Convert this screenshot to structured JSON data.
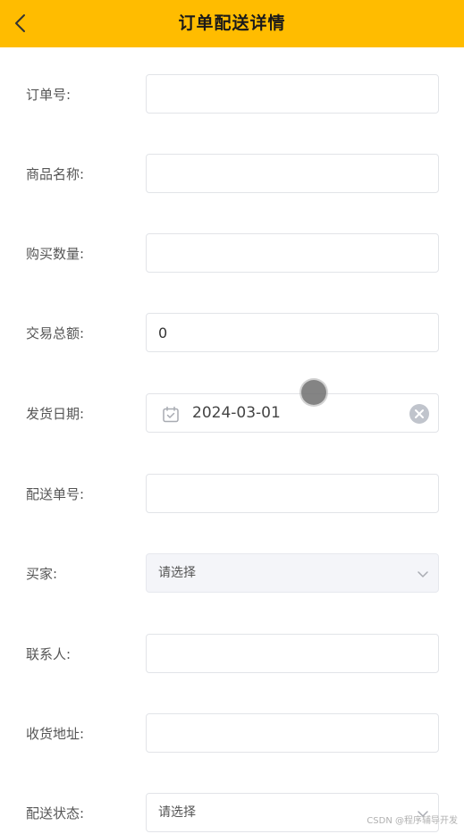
{
  "header": {
    "title": "订单配送详情",
    "background": "#FFBC00"
  },
  "form": {
    "order_no": {
      "label": "订单号:",
      "value": ""
    },
    "product_name": {
      "label": "商品名称:",
      "value": ""
    },
    "quantity": {
      "label": "购买数量:",
      "value": ""
    },
    "total_amount": {
      "label": "交易总额:",
      "value": "0"
    },
    "ship_date": {
      "label": "发货日期:",
      "value": "2024-03-01"
    },
    "delivery_no": {
      "label": "配送单号:",
      "value": ""
    },
    "buyer": {
      "label": "买家:",
      "placeholder": "请选择"
    },
    "contact": {
      "label": "联系人:",
      "value": ""
    },
    "address": {
      "label": "收货地址:",
      "value": ""
    },
    "status": {
      "label": "配送状态:",
      "placeholder": "请选择"
    }
  },
  "icons": {
    "back": "chevron-left-icon",
    "calendar": "calendar-icon",
    "clear": "clear-icon",
    "dropdown": "chevron-down-icon"
  },
  "watermark": "CSDN @程序辅导开发"
}
